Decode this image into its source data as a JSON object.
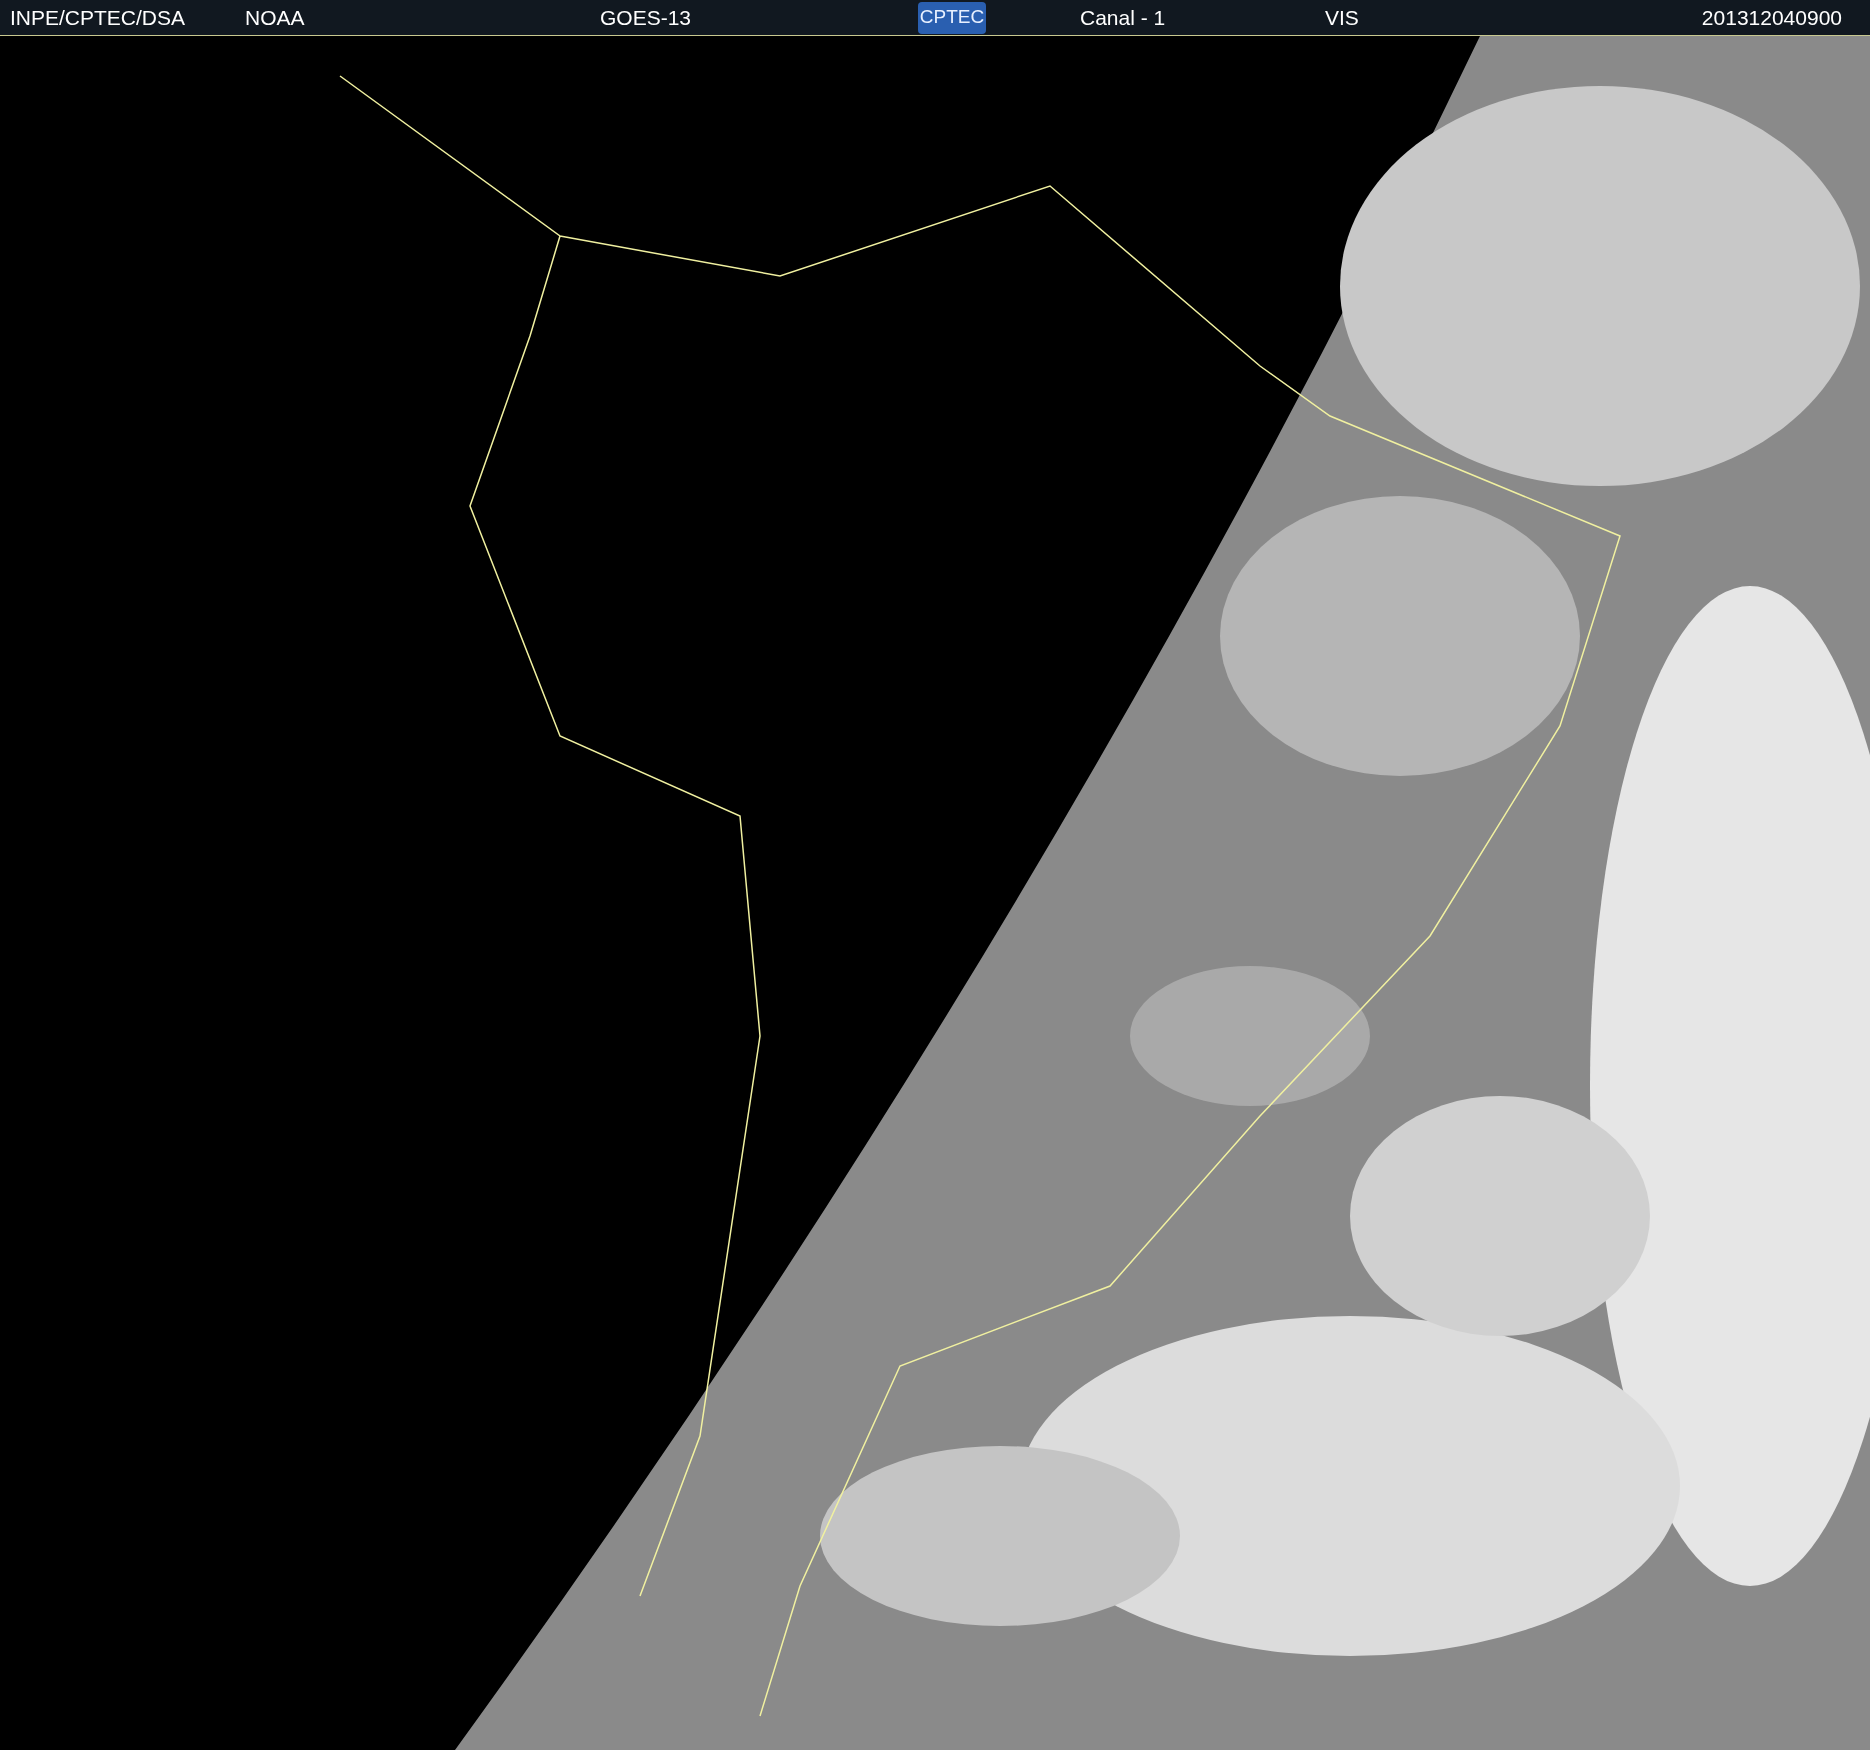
{
  "header": {
    "agency": "INPE/CPTEC/DSA",
    "source": "NOAA",
    "satellite": "GOES-13",
    "logo": "CPTEC",
    "channel": "Canal - 1",
    "band": "VIS",
    "timestamp": "201312040900"
  }
}
